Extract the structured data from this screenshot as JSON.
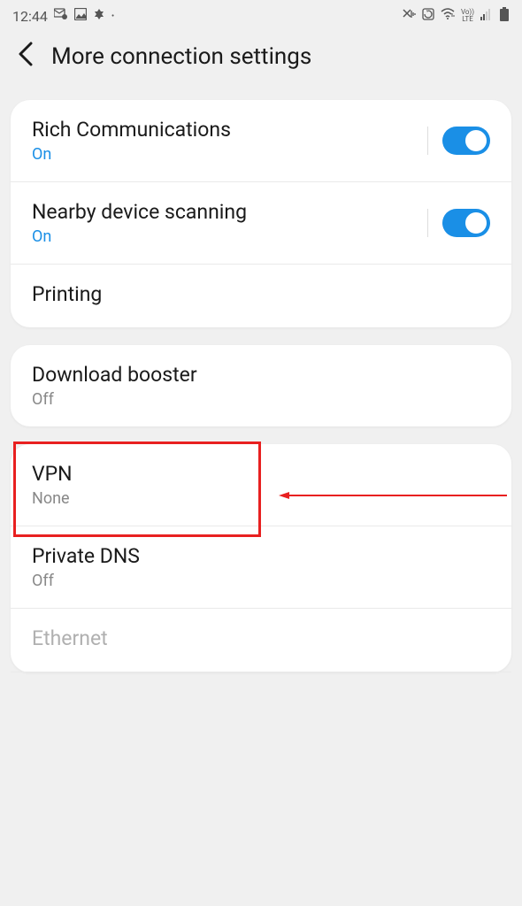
{
  "status": {
    "time": "12:44",
    "lte": "Vo))\nLTE"
  },
  "header": {
    "title": "More connection settings"
  },
  "group1": {
    "richComm": {
      "title": "Rich Communications",
      "sub": "On"
    },
    "nearby": {
      "title": "Nearby device scanning",
      "sub": "On"
    },
    "printing": {
      "title": "Printing"
    }
  },
  "group2": {
    "downloadBooster": {
      "title": "Download booster",
      "sub": "Off"
    }
  },
  "group3": {
    "vpn": {
      "title": "VPN",
      "sub": "None"
    },
    "privateDns": {
      "title": "Private DNS",
      "sub": "Off"
    },
    "ethernet": {
      "title": "Ethernet"
    }
  }
}
